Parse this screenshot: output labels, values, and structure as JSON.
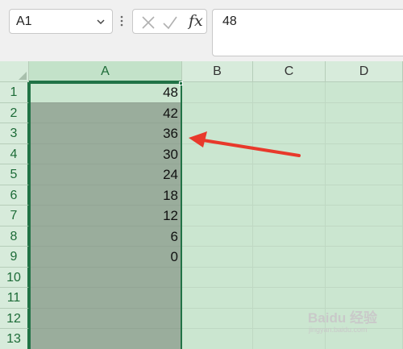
{
  "formula_bar": {
    "name_box": "A1",
    "fx_label": "fx",
    "content": "48"
  },
  "grid": {
    "columns": [
      "A",
      "B",
      "C",
      "D"
    ],
    "selected_column": "A",
    "rows": [
      {
        "num": "1",
        "a": "48"
      },
      {
        "num": "2",
        "a": "42"
      },
      {
        "num": "3",
        "a": "36"
      },
      {
        "num": "4",
        "a": "30"
      },
      {
        "num": "5",
        "a": "24"
      },
      {
        "num": "6",
        "a": "18"
      },
      {
        "num": "7",
        "a": "12"
      },
      {
        "num": "8",
        "a": "6"
      },
      {
        "num": "9",
        "a": "0"
      },
      {
        "num": "10",
        "a": ""
      },
      {
        "num": "11",
        "a": ""
      },
      {
        "num": "12",
        "a": ""
      },
      {
        "num": "13",
        "a": ""
      }
    ]
  },
  "annotation": {
    "arrow_color": "#e8392b"
  },
  "watermark": {
    "brand": "Baidu 经验",
    "url": "jingyan.baidu.com"
  },
  "colors": {
    "accent": "#217346",
    "grid_bg": "#cbe6d0",
    "selection_fill": "#9aad9c"
  }
}
